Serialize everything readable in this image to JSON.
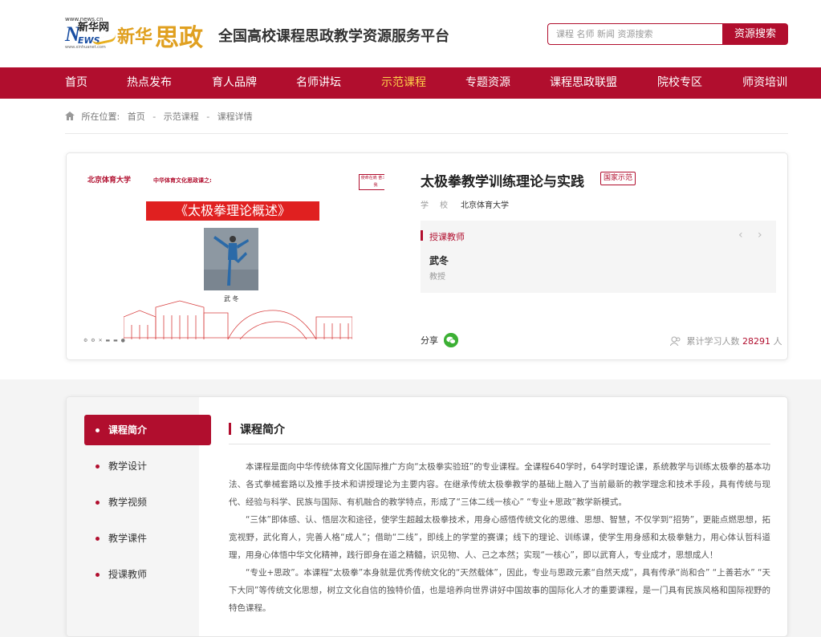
{
  "header": {
    "logo_url_top": "www.news.cn",
    "logo_xinhua": "新华网",
    "logo_news": "NEWS",
    "logo_url_bottom": "www.xinhuanet.com",
    "logo_brand": "新华",
    "logo_szheng": "思政",
    "site_title": "全国高校课程思政教学资源服务平台",
    "search_placeholder": "课程 名师 新闻 资源搜索",
    "search_button": "资源搜索"
  },
  "nav": {
    "items": [
      {
        "label": "首页",
        "active": false
      },
      {
        "label": "热点发布",
        "active": false
      },
      {
        "label": "育人品牌",
        "active": false
      },
      {
        "label": "名师讲坛",
        "active": false
      },
      {
        "label": "示范课程",
        "active": true
      },
      {
        "label": "专题资源",
        "active": false
      },
      {
        "label": "课程思政联盟",
        "active": false
      },
      {
        "label": "院校专区",
        "active": false
      },
      {
        "label": "师资培训",
        "active": false
      }
    ]
  },
  "breadcrumb": {
    "prefix": "所在位置:",
    "items": [
      "首页",
      "示范课程",
      "课程详情"
    ]
  },
  "course": {
    "cover": {
      "university": "北京体育大学",
      "series": "中华体育文化思政课之:",
      "banner": "《太极拳理论概述》",
      "stamp": "使命在肩 奋斗有我",
      "person_name": "武 冬"
    },
    "title": "太极拳教学训练理论与实践",
    "badge": "国家示范",
    "school_label": "学校",
    "school_value": "北京体育大学",
    "teacher_section_label": "授课教师",
    "teacher_name": "武冬",
    "teacher_title": "教授",
    "share_label": "分享",
    "learners_prefix": "累计学习人数",
    "learners_count": "28291",
    "learners_unit": "人"
  },
  "sidebar": {
    "items": [
      {
        "label": "课程简介",
        "active": true
      },
      {
        "label": "教学设计",
        "active": false
      },
      {
        "label": "教学视频",
        "active": false
      },
      {
        "label": "教学课件",
        "active": false
      },
      {
        "label": "授课教师",
        "active": false
      }
    ]
  },
  "intro": {
    "title": "课程简介",
    "paragraphs": [
      "本课程是面向中华传统体育文化国际推广方向“太极拳实验班”的专业课程。全课程640学时，64学时理论课，系统教学与训练太极拳的基本功法、各式拳械套路以及推手技术和讲授理论为主要内容。在继承传统太极拳教学的基础上融入了当前最新的教学理念和技术手段，具有传统与现代、经验与科学、民族与国际、有机融合的教学特点，形成了“三体二线一核心” “专业+思政”教学新模式。",
      "“三体”即体感、认、悟层次和途径，使学生超越太极拳技术，用身心感悟传统文化的思维、思想、智慧，不仅学到“招势”，更能点燃思想，拓宽视野，武化育人，完善人格“成人”；借助“二线”，即线上的学堂的赛课；线下的理论、训练课，使学生用身感和太极拳魅力，用心体认哲科道理，用身心体悟中华文化精神，践行即身在道之精髓，识见物、人、己之本然；实现“一核心”，即以武育人，专业成才，思想成人！",
      "“专业+思政”。本课程“太极拳”本身就是优秀传统文化的“天然载体”，因此，专业与思政元素“自然天成”，具有传承“尚和合” “上善若水” “天下大同”等传统文化思想，树立文化自信的独特价值，也是培养向世界讲好中国故事的国际化人才的重要课程，是一门具有民族风格和国际视野的特色课程。"
    ]
  },
  "colors": {
    "brand_red": "#b10e2e",
    "nav_active": "#ffd24a",
    "logo_gold": "#e0a020",
    "news_blue": "#1a4fa3",
    "wechat_green": "#3cb034"
  },
  "icons": {
    "home": "home-icon",
    "wechat": "wechat-icon",
    "person": "person-icon",
    "prev": "chevron-left-icon",
    "next": "chevron-right-icon"
  }
}
